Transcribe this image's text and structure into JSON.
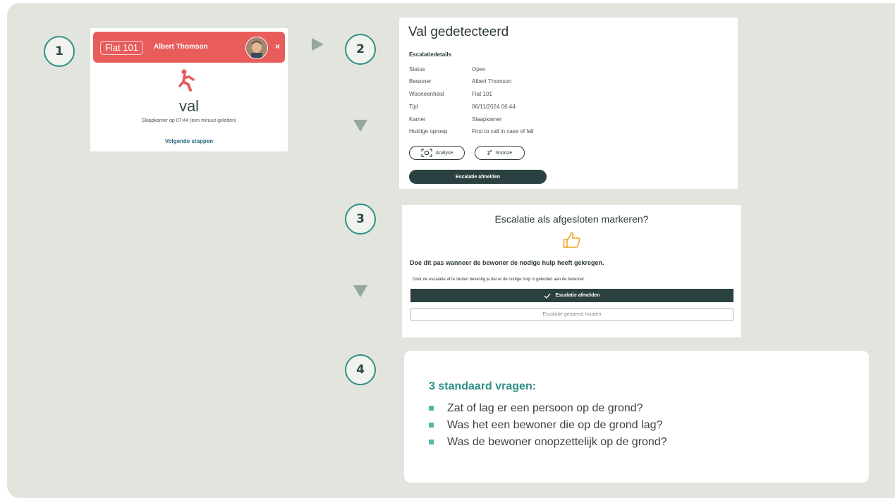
{
  "steps": [
    "1",
    "2",
    "3",
    "4"
  ],
  "colors": {
    "teal": "#2f8f87",
    "alert_red": "#e85c5c",
    "dark_button": "#2b4040",
    "thumb_orange": "#f0a326",
    "panel_bg": "#e2e5dd"
  },
  "alert_card": {
    "flat_badge": "Flat 101",
    "resident": "Albert Thomson",
    "close_glyph": "×",
    "icon": "falling-person-icon",
    "title": "val",
    "subtitle": "Slaapkamer op 07:44 (een minuut geleden)",
    "link": "Volgende stappen"
  },
  "details_card": {
    "title": "Val gedetecteerd",
    "section": "Escalatiedetails",
    "rows": [
      {
        "label": "Status",
        "value": "Open"
      },
      {
        "label": "Bewoner",
        "value": "Albert Thomson"
      },
      {
        "label": "Wooneenheid",
        "value": "Flat 101"
      },
      {
        "label": "Tijd",
        "value": "06/11/2024 06:44"
      },
      {
        "label": "Kamer",
        "value": "Slaapkamer"
      },
      {
        "label": "Huidige oproep",
        "value": "First to call in case of fall"
      }
    ],
    "analyse_label": "Analyse",
    "snooze_label": "Snooze",
    "close_escalation_label": "Escalatie afmelden"
  },
  "confirm_card": {
    "title": "Escalatie als afgesloten markeren?",
    "icon": "thumbs-up-icon",
    "line1": "Doe dit pas wanneer de bewoner de nodige hulp heeft gekregen.",
    "line2": "Door de escalatie af te sluiten bevestig je dat er de nodige hulp is geboden aan de bewoner.",
    "confirm_label": "Escalatie afmelden",
    "keep_open_label": "Escalatie geopend houden"
  },
  "questions_card": {
    "heading": "3 standaard vragen:",
    "items": [
      "Zat of lag er een persoon op de grond?",
      "Was het een bewoner die op de grond lag?",
      "Was de bewoner onopzettelijk op de grond?"
    ]
  }
}
